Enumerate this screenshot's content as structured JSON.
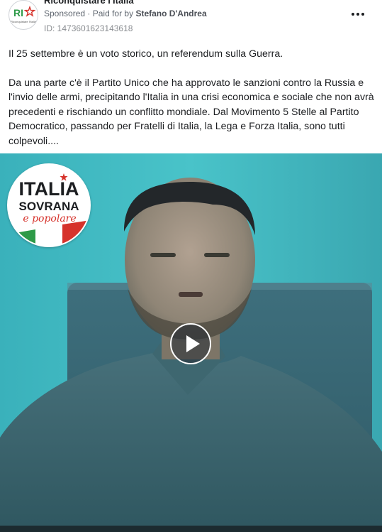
{
  "post": {
    "page_name": "Riconquistare l'Italia",
    "sponsored": "Sponsored",
    "paid_for_prefix": "· Paid for by",
    "paid_for_by": "Stefano D'Andrea",
    "ad_id": "ID: 1473601623143618",
    "avatar_logo_text": "RI",
    "avatar_logo_sub": "Riconquistare l'Italia"
  },
  "body": {
    "paragraph1": "Il 25 settembre è un voto storico, un referendum sulla Guerra.",
    "paragraph2": "Da una parte c'è il Partito Unico che ha approvato le sanzioni contro la Russia e l'invio delle armi, precipitando l'Italia in una crisi economica e sociale che non avrà precedenti e rischiando un conflitto mondiale. Dal Movimento 5 Stelle al Partito Democratico, passando per Fratelli di Italia, la Lega e Forza Italia, sono tutti colpevoli...."
  },
  "video": {
    "logo_line1": "ITALIA",
    "logo_line2": "SOVRANA",
    "logo_line3": "e popolare"
  },
  "icons": {
    "more": "more-horizontal-icon",
    "play": "play-icon"
  },
  "colors": {
    "logo_red": "#d6322b",
    "flag_green": "#2e9a48",
    "flag_red": "#d6322b",
    "video_bg": "#3a7e88"
  }
}
